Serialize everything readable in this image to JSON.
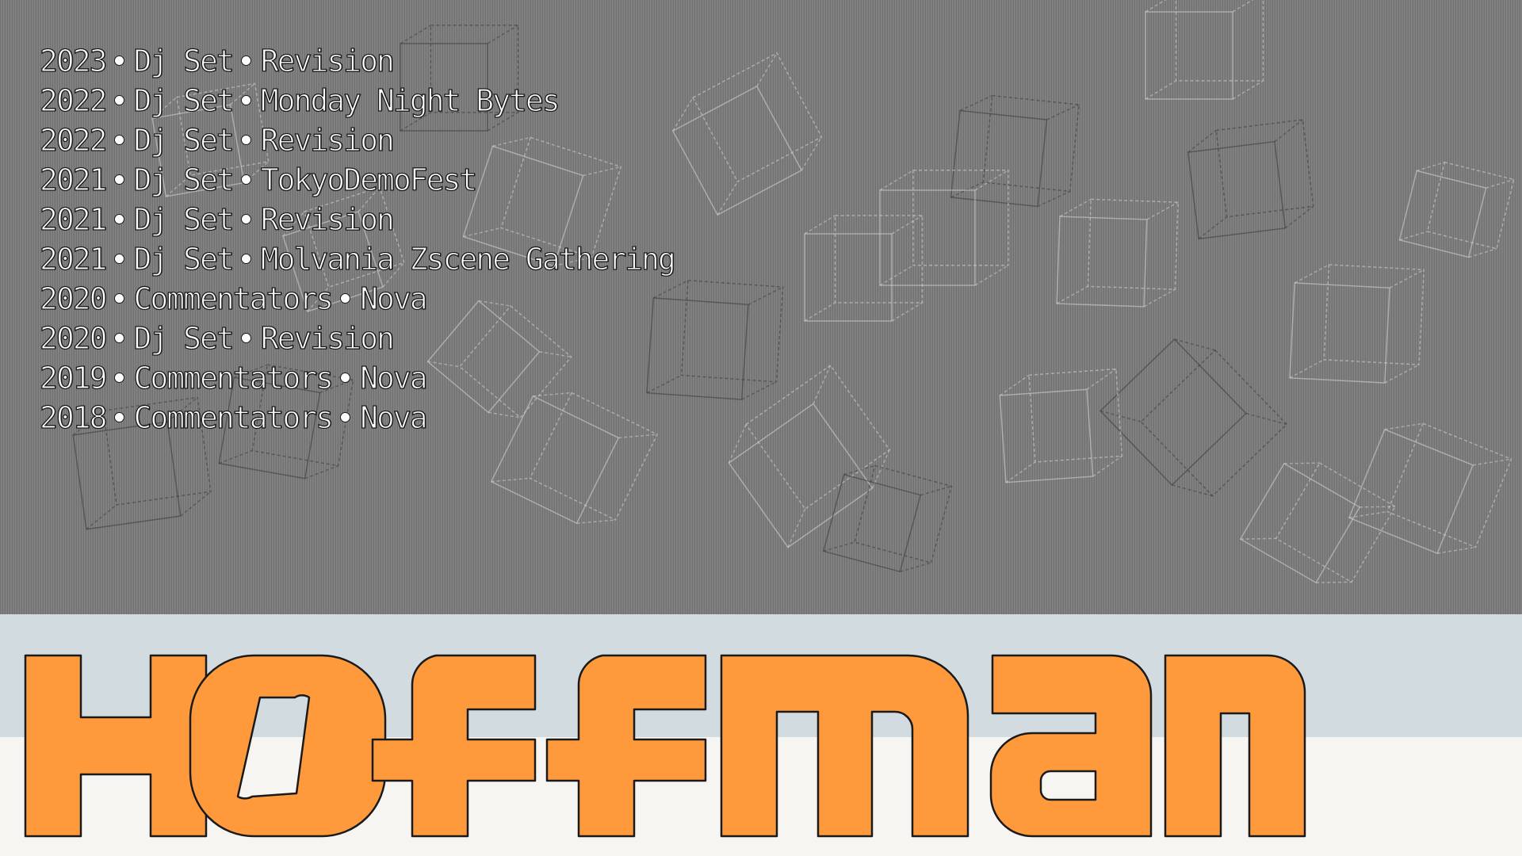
{
  "entries": [
    {
      "year": "2023",
      "role": "Dj Set",
      "event": "Revision"
    },
    {
      "year": "2022",
      "role": "Dj Set",
      "event": "Monday Night Bytes"
    },
    {
      "year": "2022",
      "role": "Dj Set",
      "event": "Revision"
    },
    {
      "year": "2021",
      "role": "Dj Set",
      "event": "TokyoDemoFest"
    },
    {
      "year": "2021",
      "role": "Dj Set",
      "event": "Revision"
    },
    {
      "year": "2021",
      "role": "Dj Set",
      "event": "Molvania Zscene Gathering"
    },
    {
      "year": "2020",
      "role": "Commentators",
      "event": "Nova"
    },
    {
      "year": "2020",
      "role": "Dj Set",
      "event": "Revision"
    },
    {
      "year": "2019",
      "role": "Commentators",
      "event": "Nova"
    },
    {
      "year": "2018",
      "role": "Commentators",
      "event": "Nova"
    }
  ],
  "logo": {
    "text": "Høffman",
    "fill_color": "#ff9a3c",
    "stroke_color": "#1a1a1a"
  },
  "colors": {
    "background": "#7d7d7d",
    "band_blue": "#d1dbe0",
    "band_white": "#f6f5f2",
    "text": "#ffffff",
    "text_outline": "#1a1a1a"
  },
  "icons": {
    "separator": "bullet-dot-icon",
    "background_art": "wireframe-cubes"
  }
}
